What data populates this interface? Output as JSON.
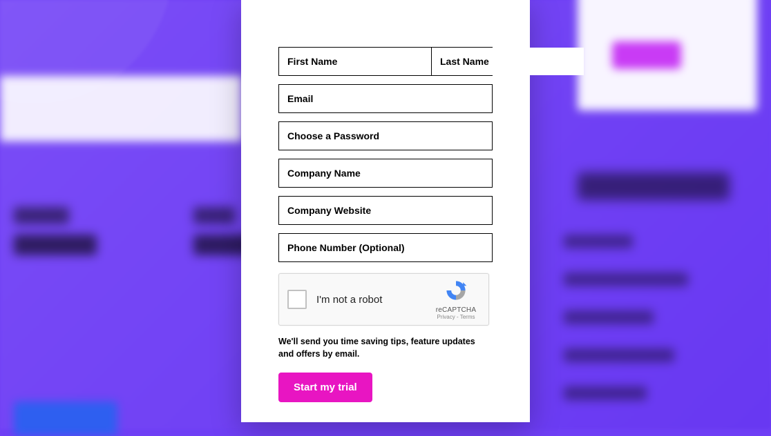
{
  "form": {
    "first_name_placeholder": "First Name",
    "last_name_placeholder": "Last Name",
    "email_placeholder": "Email",
    "password_placeholder": "Choose a Password",
    "company_name_placeholder": "Company Name",
    "company_website_placeholder": "Company Website",
    "phone_placeholder": "Phone Number (Optional)"
  },
  "captcha": {
    "label": "I'm not a robot",
    "brand": "reCAPTCHA",
    "links": "Privacy - Terms"
  },
  "disclosure": "We'll send you time saving tips, feature updates and offers by email.",
  "submit_label": "Start my trial"
}
